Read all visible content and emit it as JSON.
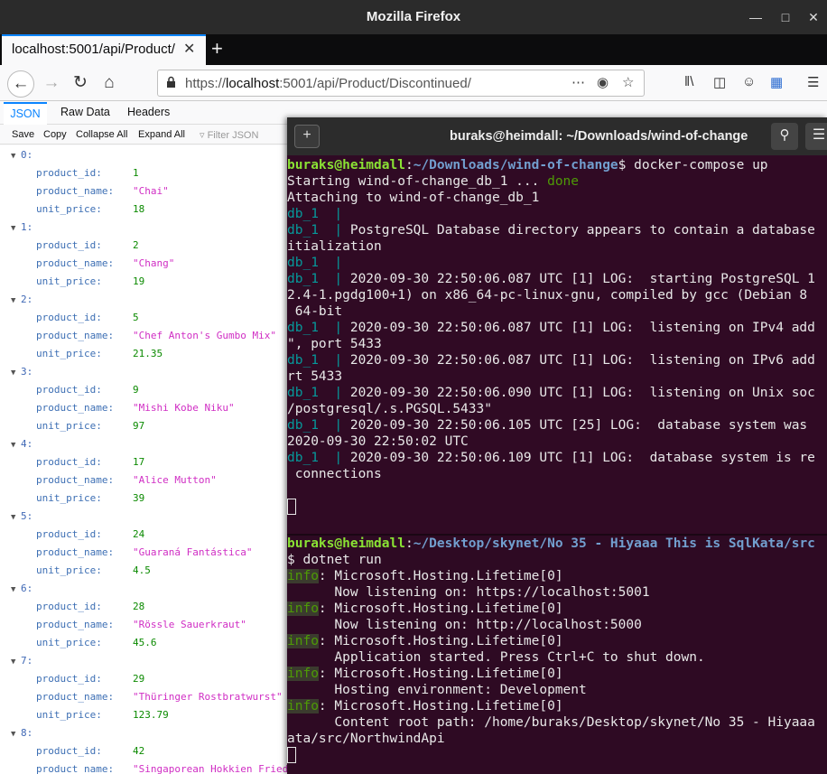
{
  "firefox": {
    "window_title": "Mozilla Firefox",
    "tab_title": "localhost:5001/api/Product/",
    "url_scheme": "https://",
    "url_host": "localhost",
    "url_rest": ":5001/api/Product/Discontinued/",
    "json_viewer": {
      "tabs": [
        "JSON",
        "Raw Data",
        "Headers"
      ],
      "toolbar": [
        "Save",
        "Copy",
        "Collapse All",
        "Expand All"
      ],
      "filter_placeholder": "Filter JSON",
      "items": [
        {
          "index": "0:",
          "product_id": "1",
          "product_name": "\"Chai\"",
          "unit_price": "18"
        },
        {
          "index": "1:",
          "product_id": "2",
          "product_name": "\"Chang\"",
          "unit_price": "19"
        },
        {
          "index": "2:",
          "product_id": "5",
          "product_name": "\"Chef Anton's Gumbo Mix\"",
          "unit_price": "21.35"
        },
        {
          "index": "3:",
          "product_id": "9",
          "product_name": "\"Mishi Kobe Niku\"",
          "unit_price": "97"
        },
        {
          "index": "4:",
          "product_id": "17",
          "product_name": "\"Alice Mutton\"",
          "unit_price": "39"
        },
        {
          "index": "5:",
          "product_id": "24",
          "product_name": "\"Guaraná Fantástica\"",
          "unit_price": "4.5"
        },
        {
          "index": "6:",
          "product_id": "28",
          "product_name": "\"Rössle Sauerkraut\"",
          "unit_price": "45.6"
        },
        {
          "index": "7:",
          "product_id": "29",
          "product_name": "\"Thüringer Rostbratwurst\"",
          "unit_price": "123.79"
        },
        {
          "index": "8:",
          "product_id": "42",
          "product_name": "\"Singaporean Hokkien Fried",
          "unit_price": ""
        }
      ],
      "keys": {
        "id": "product_id:",
        "name": "product_name:",
        "price": "unit_price:"
      }
    }
  },
  "terminal": {
    "title": "buraks@heimdall: ~/Downloads/wind-of-change",
    "pane1": [
      [
        [
          "c-prompt",
          "buraks@heimdall"
        ],
        [
          "",
          ""
        ],
        [
          "",
          ":"
        ],
        [
          "c-path",
          "~/Downloads/wind-of-change"
        ],
        [
          "",
          "$ docker-compose up"
        ]
      ],
      [
        [
          "",
          "Starting wind-of-change_db_1 ... "
        ],
        [
          "c-done",
          "done"
        ]
      ],
      [
        [
          "",
          "Attaching to wind-of-change_db_1"
        ]
      ],
      [
        [
          "c-db",
          "db_1  |"
        ]
      ],
      [
        [
          "c-db",
          "db_1  |"
        ],
        [
          "",
          " PostgreSQL Database directory appears to contain a database"
        ]
      ],
      [
        [
          "",
          "itialization"
        ]
      ],
      [
        [
          "c-db",
          "db_1  |"
        ]
      ],
      [
        [
          "c-db",
          "db_1  |"
        ],
        [
          "",
          " 2020-09-30 22:50:06.087 UTC [1] LOG:  starting PostgreSQL 1"
        ]
      ],
      [
        [
          "",
          "2.4-1.pgdg100+1) on x86_64-pc-linux-gnu, compiled by gcc (Debian 8"
        ]
      ],
      [
        [
          "",
          " 64-bit"
        ]
      ],
      [
        [
          "c-db",
          "db_1  |"
        ],
        [
          "",
          " 2020-09-30 22:50:06.087 UTC [1] LOG:  listening on IPv4 add"
        ]
      ],
      [
        [
          "",
          "\", port 5433"
        ]
      ],
      [
        [
          "c-db",
          "db_1  |"
        ],
        [
          "",
          " 2020-09-30 22:50:06.087 UTC [1] LOG:  listening on IPv6 add"
        ]
      ],
      [
        [
          "",
          "rt 5433"
        ]
      ],
      [
        [
          "c-db",
          "db_1  |"
        ],
        [
          "",
          " 2020-09-30 22:50:06.090 UTC [1] LOG:  listening on Unix soc"
        ]
      ],
      [
        [
          "",
          "/postgresql/.s.PGSQL.5433\""
        ]
      ],
      [
        [
          "c-db",
          "db_1  |"
        ],
        [
          "",
          " 2020-09-30 22:50:06.105 UTC [25] LOG:  database system was"
        ]
      ],
      [
        [
          "",
          "2020-09-30 22:50:02 UTC"
        ]
      ],
      [
        [
          "c-db",
          "db_1  |"
        ],
        [
          "",
          " 2020-09-30 22:50:06.109 UTC [1] LOG:  database system is re"
        ]
      ],
      [
        [
          "",
          " connections"
        ]
      ],
      [
        [
          "",
          ""
        ]
      ],
      [
        [
          "cursor",
          ""
        ]
      ]
    ],
    "pane2": [
      [
        [
          "c-prompt",
          "buraks@heimdall"
        ],
        [
          "",
          ":"
        ],
        [
          "c-path",
          "~/Desktop/skynet/No 35 - Hiyaaa This is SqlKata/src"
        ]
      ],
      [
        [
          "",
          "$ dotnet run"
        ]
      ],
      [
        [
          "c-info",
          "info"
        ],
        [
          "",
          ": Microsoft.Hosting.Lifetime[0]"
        ]
      ],
      [
        [
          "",
          "      Now listening on: https://localhost:5001"
        ]
      ],
      [
        [
          "c-info",
          "info"
        ],
        [
          "",
          ": Microsoft.Hosting.Lifetime[0]"
        ]
      ],
      [
        [
          "",
          "      Now listening on: http://localhost:5000"
        ]
      ],
      [
        [
          "c-info",
          "info"
        ],
        [
          "",
          ": Microsoft.Hosting.Lifetime[0]"
        ]
      ],
      [
        [
          "",
          "      Application started. Press Ctrl+C to shut down."
        ]
      ],
      [
        [
          "c-info",
          "info"
        ],
        [
          "",
          ": Microsoft.Hosting.Lifetime[0]"
        ]
      ],
      [
        [
          "",
          "      Hosting environment: Development"
        ]
      ],
      [
        [
          "c-info",
          "info"
        ],
        [
          "",
          ": Microsoft.Hosting.Lifetime[0]"
        ]
      ],
      [
        [
          "",
          "      Content root path: /home/buraks/Desktop/skynet/No 35 - Hiyaaa"
        ]
      ],
      [
        [
          "",
          "ata/src/NorthwindApi"
        ]
      ],
      [
        [
          "cursor",
          ""
        ]
      ]
    ]
  }
}
